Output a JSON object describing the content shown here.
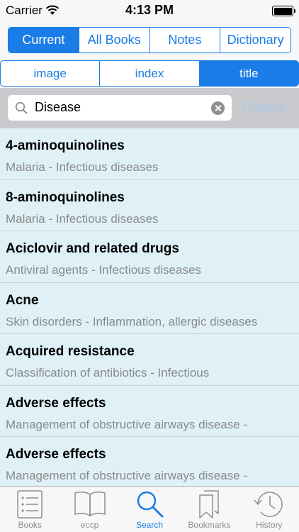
{
  "status": {
    "carrier": "Carrier",
    "time": "4:13 PM"
  },
  "main_tabs": [
    {
      "label": "Current",
      "active": true
    },
    {
      "label": "All Books",
      "active": false
    },
    {
      "label": "Notes",
      "active": false
    },
    {
      "label": "Dictionary",
      "active": false
    }
  ],
  "filter_tabs": [
    {
      "label": "image",
      "active": false
    },
    {
      "label": "index",
      "active": false
    },
    {
      "label": "title",
      "active": true
    }
  ],
  "search": {
    "value": "Disease",
    "cancel_label": "Cancel"
  },
  "results": [
    {
      "title": "4-aminoquinolines",
      "subtitle": "Malaria - Infectious diseases"
    },
    {
      "title": "8-aminoquinolines",
      "subtitle": "Malaria - Infectious diseases"
    },
    {
      "title": "Aciclovir and related drugs",
      "subtitle": "Antiviral agents - Infectious diseases"
    },
    {
      "title": "Acne",
      "subtitle": "Skin disorders - Inflammation, allergic diseases"
    },
    {
      "title": "Acquired resistance",
      "subtitle": "Classification of antibiotics - Infectious"
    },
    {
      "title": "Adverse effects",
      "subtitle": "Management of obstructive airways disease -"
    },
    {
      "title": "Adverse effects",
      "subtitle": "Management of obstructive airways disease -"
    }
  ],
  "tabbar": [
    {
      "label": "Books",
      "icon": "books-icon",
      "active": false
    },
    {
      "label": "eccp",
      "icon": "open-book-icon",
      "active": false
    },
    {
      "label": "Search",
      "icon": "search-icon",
      "active": true
    },
    {
      "label": "Bookmarks",
      "icon": "bookmarks-icon",
      "active": false
    },
    {
      "label": "History",
      "icon": "history-icon",
      "active": false
    }
  ],
  "colors": {
    "accent": "#1a7ce6",
    "list_bg": "#dff1f7",
    "subtitle": "#8a8a8a"
  }
}
